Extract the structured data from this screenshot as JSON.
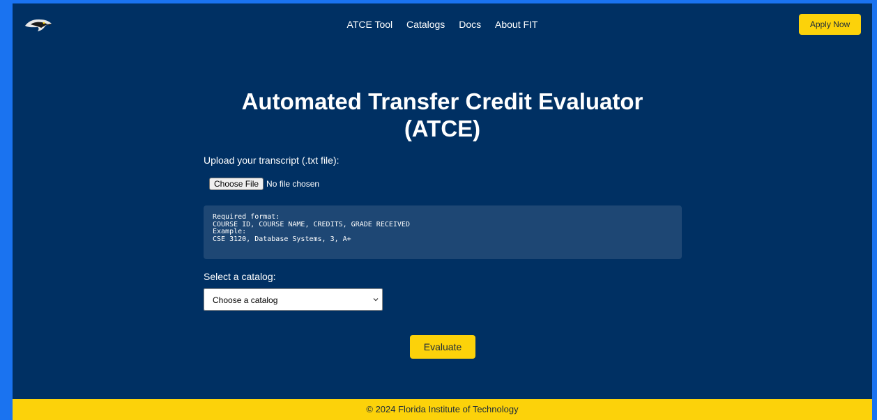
{
  "header": {
    "nav": [
      "ATCE Tool",
      "Catalogs",
      "Docs",
      "About FIT"
    ],
    "apply_label": "Apply Now"
  },
  "main": {
    "title_line1": "Automated Transfer Credit Evaluator",
    "title_line2": "(ATCE)",
    "upload_label": "Upload your transcript (.txt file):",
    "choose_file_label": "Choose File",
    "file_status": "No file chosen",
    "format_lines": [
      "Required format:",
      "COURSE ID, COURSE NAME, CREDITS, GRADE RECEIVED",
      "Example:",
      "CSE 3120, Database Systems, 3, A+"
    ],
    "catalog_label": "Select a catalog:",
    "catalog_selected": "Choose a catalog",
    "evaluate_label": "Evaluate"
  },
  "footer": {
    "text": "© 2024 Florida Institute of Technology"
  },
  "icons": {
    "logo": "panther-logo-icon",
    "select": "chevron-down-icon"
  },
  "colors": {
    "background": "#003063",
    "accent": "#fcd20a",
    "format_box": "#1e4774"
  }
}
